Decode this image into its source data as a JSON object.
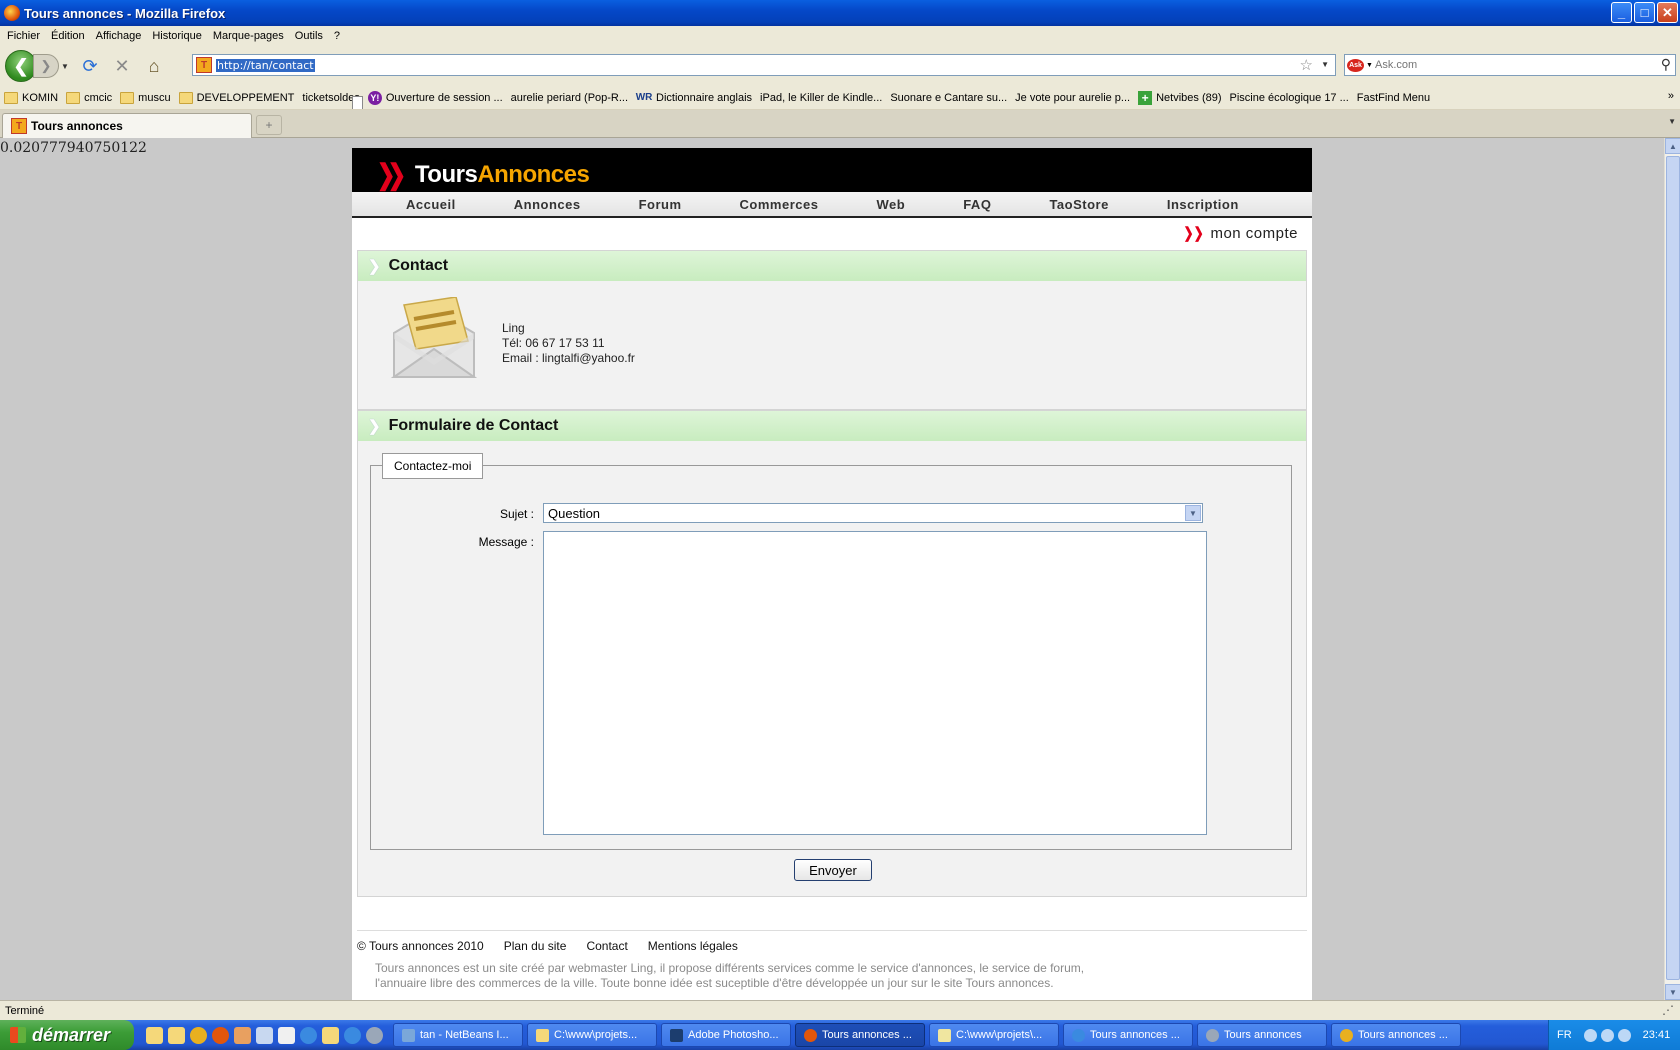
{
  "window": {
    "title": "Tours annonces - Mozilla Firefox",
    "buttons": {
      "minimize": "_",
      "maximize": "□",
      "close": "✕"
    }
  },
  "menu": [
    "Fichier",
    "Édition",
    "Affichage",
    "Historique",
    "Marque-pages",
    "Outils",
    "?"
  ],
  "toolbar": {
    "url": "http://tan/contact",
    "search_placeholder": "Ask.com",
    "search_engine": "Ask",
    "icons": [
      "back-icon",
      "forward-icon",
      "reload-icon",
      "stop-icon",
      "home-icon",
      "star-icon",
      "magnifier-icon"
    ]
  },
  "bookmarks": [
    {
      "label": "KOMIN",
      "icon": "folder"
    },
    {
      "label": "cmcic",
      "icon": "folder"
    },
    {
      "label": "muscu",
      "icon": "folder"
    },
    {
      "label": "DEVELOPPEMENT",
      "icon": "folder"
    },
    {
      "label": "ticketsoldes",
      "icon": "page"
    },
    {
      "label": "Ouverture de session ...",
      "icon": "yahoo"
    },
    {
      "label": "aurelie periard (Pop-R...",
      "icon": "page"
    },
    {
      "label": "Dictionnaire anglais",
      "icon": "wr"
    },
    {
      "label": "iPad, le Killer de Kindle...",
      "icon": "page"
    },
    {
      "label": "Suonare e Cantare su...",
      "icon": "page"
    },
    {
      "label": "Je vote pour aurelie p...",
      "icon": "page"
    },
    {
      "label": "Netvibes (89)",
      "icon": "plus"
    },
    {
      "label": "Piscine écologique 17 ...",
      "icon": "page"
    },
    {
      "label": "FastFind Menu",
      "icon": "page"
    }
  ],
  "bookmarks_more": "»",
  "tabs": [
    {
      "label": "Tours annonces",
      "favicon": "T"
    }
  ],
  "newtab": "+",
  "debug_number": "0.020777940750122",
  "site": {
    "logo": {
      "part1": "Tours",
      "part2": "Annonces"
    },
    "nav": [
      "Accueil",
      "Annonces",
      "Forum",
      "Commerces",
      "Web",
      "FAQ",
      "TaoStore",
      "Inscription"
    ],
    "account": "mon compte",
    "contact": {
      "heading": "Contact",
      "name": "Ling",
      "phone": "Tél: 06 67 17 53 11",
      "email": "Email : lingtalfi@yahoo.fr"
    },
    "form": {
      "heading": "Formulaire de Contact",
      "legend": "Contactez-moi",
      "subject_label": "Sujet :",
      "subject_value": "Question",
      "message_label": "Message :",
      "message_value": "",
      "submit": "Envoyer"
    },
    "footer": {
      "links": [
        "© Tours annonces 2010",
        "Plan du site",
        "Contact",
        "Mentions légales"
      ],
      "text": "Tours annonces est un site créé par webmaster Ling, il propose différents services comme le service d'annonces, le service de forum, l'annuaire libre des commerces de la ville. Toute bonne idée est suceptible d'être développée un jour sur le site Tours annonces."
    }
  },
  "status": "Terminé",
  "taskbar": {
    "start": "démarrer",
    "tasks": [
      {
        "label": "tan - NetBeans I...",
        "color": "#7aa7d9",
        "active": false
      },
      {
        "label": "C:\\www\\projets...",
        "color": "#f5d87a",
        "active": false
      },
      {
        "label": "Adobe Photosho...",
        "color": "#1c3d6e",
        "active": false
      },
      {
        "label": "Tours annonces ...",
        "color": "#e2560b",
        "active": true
      },
      {
        "label": "C:\\www\\projets\\...",
        "color": "#f0e6a0",
        "active": false
      },
      {
        "label": "Tours annonces ...",
        "color": "#3a8ae0",
        "active": false
      },
      {
        "label": "Tours annonces",
        "color": "#9aa7b8",
        "active": false
      },
      {
        "label": "Tours annonces ...",
        "color": "#e8b020",
        "active": false
      }
    ],
    "lang": "FR",
    "clock": "23:41"
  }
}
